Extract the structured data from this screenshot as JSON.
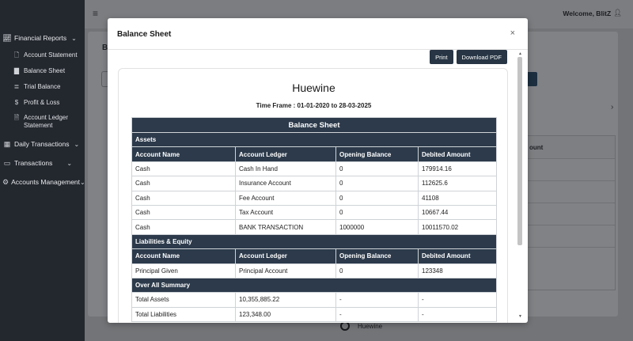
{
  "sidebar": {
    "groups": [
      {
        "label": "Financial Reports",
        "icon": "chart-line-icon",
        "expanded": true,
        "items": [
          {
            "label": "Account Statement",
            "icon": "file-icon"
          },
          {
            "label": "Balance Sheet",
            "icon": "bar-chart-icon"
          },
          {
            "label": "Trial Balance",
            "icon": "list-icon"
          },
          {
            "label": "Profit & Loss",
            "icon": "dollar-icon"
          },
          {
            "label": "Account Ledger",
            "label2": "Statement",
            "icon": "book-icon"
          }
        ]
      },
      {
        "label": "Daily Transactions",
        "icon": "calendar-icon"
      },
      {
        "label": "Transactions",
        "icon": "folder-icon"
      },
      {
        "label": "Accounts Management",
        "icon": "gear-icon"
      }
    ]
  },
  "header": {
    "welcome": "Welcome, BlitZ"
  },
  "background": {
    "page_label": "Ba",
    "col_header": "ount",
    "footer_name": "Huewine"
  },
  "modal": {
    "title": "Balance Sheet",
    "close": "×",
    "print_label": "Print",
    "pdf_label": "Download PDF",
    "company": "Huewine",
    "timeframe": "Time Frame : 01-01-2020 to 28-03-2025",
    "table_title": "Balance Sheet",
    "assets": {
      "section": "Assets",
      "columns": [
        "Account Name",
        "Account Ledger",
        "Opening Balance",
        "Debited Amount"
      ],
      "rows": [
        [
          "Cash",
          "Cash In Hand",
          "0",
          "179914.16"
        ],
        [
          "Cash",
          "Insurance Account",
          "0",
          "112625.6"
        ],
        [
          "Cash",
          "Fee Account",
          "0",
          "41108"
        ],
        [
          "Cash",
          "Tax Account",
          "0",
          "10667.44"
        ],
        [
          "Cash",
          "BANK TRANSACTION",
          "1000000",
          "10011570.02"
        ]
      ]
    },
    "liabilities": {
      "section": "Liabilities & Equity",
      "columns": [
        "Account Name",
        "Account Ledger",
        "Opening Balance",
        "Debited Amount"
      ],
      "rows": [
        [
          "Principal Given",
          "Principal Account",
          "0",
          "123348"
        ]
      ]
    },
    "summary": {
      "section": "Over All Summary",
      "rows": [
        [
          "Total Assets",
          "10,355,885.22",
          "-",
          "-"
        ],
        [
          "Total Liabilities",
          "123,348.00",
          "-",
          "-"
        ]
      ]
    }
  }
}
